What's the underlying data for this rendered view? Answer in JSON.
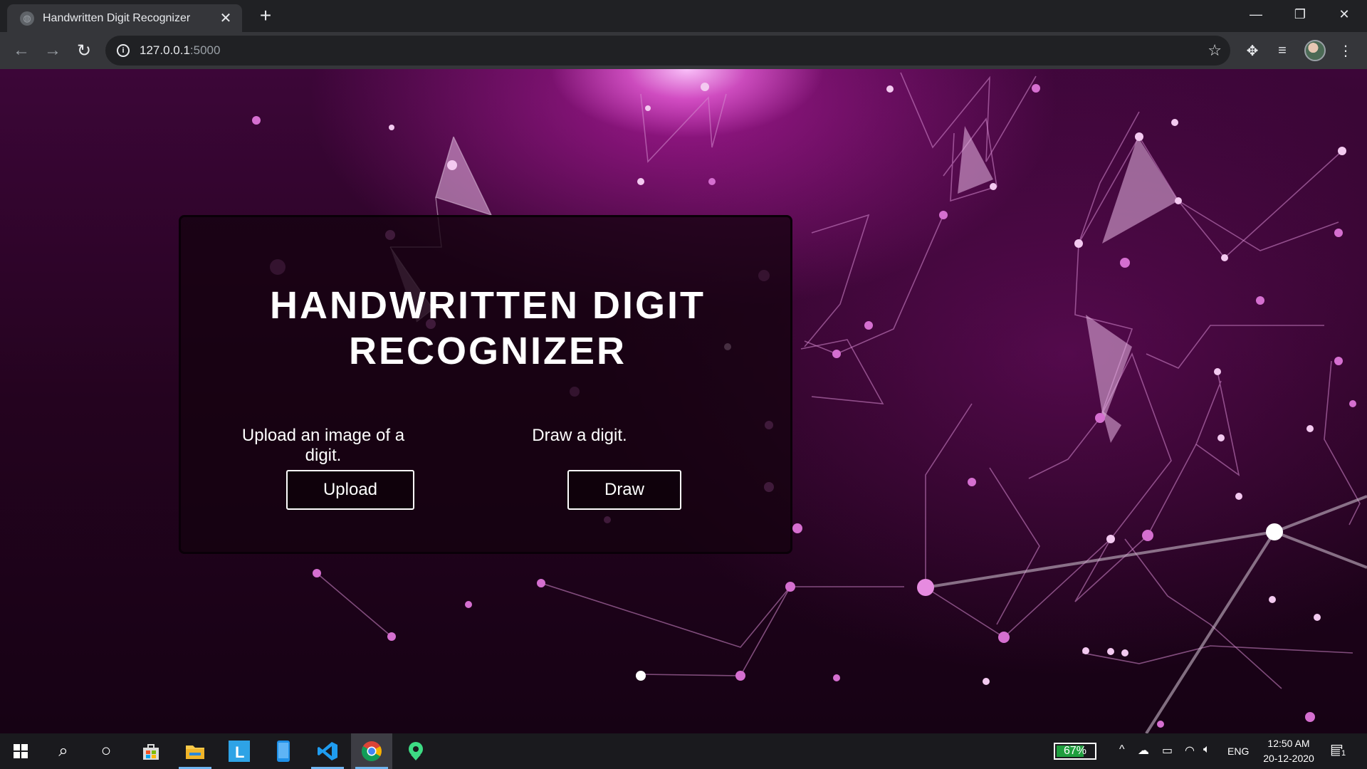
{
  "browser": {
    "tab_title": "Handwritten Digit Recognizer",
    "url_host": "127.0.0.1",
    "url_port": ":5000"
  },
  "page": {
    "title_line1": "HANDWRITTEN DIGIT",
    "title_line2": "RECOGNIZER",
    "upload": {
      "label": "Upload an image of a digit.",
      "button": "Upload"
    },
    "draw": {
      "label": "Draw a digit.",
      "button": "Draw"
    }
  },
  "taskbar": {
    "battery": "67%",
    "language": "ENG",
    "time": "12:50 AM",
    "date": "20-12-2020",
    "notification_count": "1"
  }
}
